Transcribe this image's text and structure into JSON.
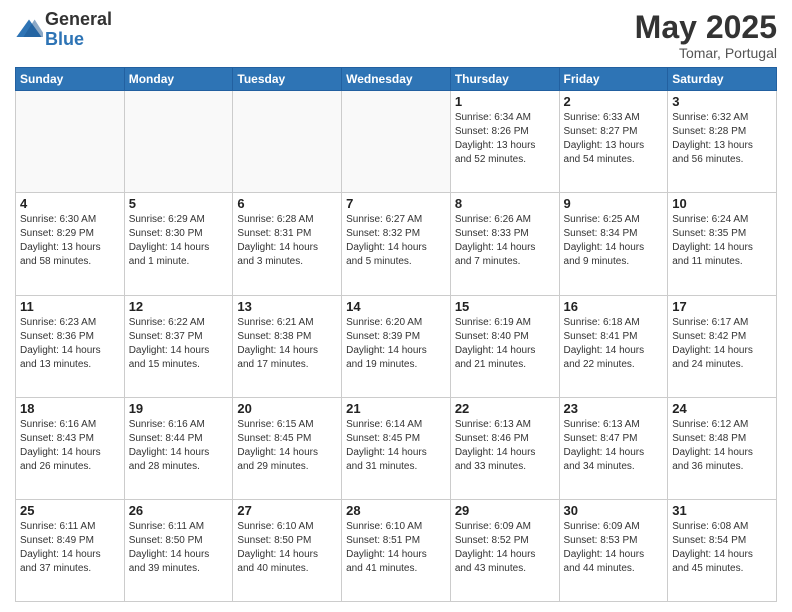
{
  "header": {
    "logo_general": "General",
    "logo_blue": "Blue",
    "title": "May 2025",
    "location": "Tomar, Portugal"
  },
  "days_of_week": [
    "Sunday",
    "Monday",
    "Tuesday",
    "Wednesday",
    "Thursday",
    "Friday",
    "Saturday"
  ],
  "weeks": [
    [
      {
        "day": "",
        "info": ""
      },
      {
        "day": "",
        "info": ""
      },
      {
        "day": "",
        "info": ""
      },
      {
        "day": "",
        "info": ""
      },
      {
        "day": "1",
        "info": "Sunrise: 6:34 AM\nSunset: 8:26 PM\nDaylight: 13 hours\nand 52 minutes."
      },
      {
        "day": "2",
        "info": "Sunrise: 6:33 AM\nSunset: 8:27 PM\nDaylight: 13 hours\nand 54 minutes."
      },
      {
        "day": "3",
        "info": "Sunrise: 6:32 AM\nSunset: 8:28 PM\nDaylight: 13 hours\nand 56 minutes."
      }
    ],
    [
      {
        "day": "4",
        "info": "Sunrise: 6:30 AM\nSunset: 8:29 PM\nDaylight: 13 hours\nand 58 minutes."
      },
      {
        "day": "5",
        "info": "Sunrise: 6:29 AM\nSunset: 8:30 PM\nDaylight: 14 hours\nand 1 minute."
      },
      {
        "day": "6",
        "info": "Sunrise: 6:28 AM\nSunset: 8:31 PM\nDaylight: 14 hours\nand 3 minutes."
      },
      {
        "day": "7",
        "info": "Sunrise: 6:27 AM\nSunset: 8:32 PM\nDaylight: 14 hours\nand 5 minutes."
      },
      {
        "day": "8",
        "info": "Sunrise: 6:26 AM\nSunset: 8:33 PM\nDaylight: 14 hours\nand 7 minutes."
      },
      {
        "day": "9",
        "info": "Sunrise: 6:25 AM\nSunset: 8:34 PM\nDaylight: 14 hours\nand 9 minutes."
      },
      {
        "day": "10",
        "info": "Sunrise: 6:24 AM\nSunset: 8:35 PM\nDaylight: 14 hours\nand 11 minutes."
      }
    ],
    [
      {
        "day": "11",
        "info": "Sunrise: 6:23 AM\nSunset: 8:36 PM\nDaylight: 14 hours\nand 13 minutes."
      },
      {
        "day": "12",
        "info": "Sunrise: 6:22 AM\nSunset: 8:37 PM\nDaylight: 14 hours\nand 15 minutes."
      },
      {
        "day": "13",
        "info": "Sunrise: 6:21 AM\nSunset: 8:38 PM\nDaylight: 14 hours\nand 17 minutes."
      },
      {
        "day": "14",
        "info": "Sunrise: 6:20 AM\nSunset: 8:39 PM\nDaylight: 14 hours\nand 19 minutes."
      },
      {
        "day": "15",
        "info": "Sunrise: 6:19 AM\nSunset: 8:40 PM\nDaylight: 14 hours\nand 21 minutes."
      },
      {
        "day": "16",
        "info": "Sunrise: 6:18 AM\nSunset: 8:41 PM\nDaylight: 14 hours\nand 22 minutes."
      },
      {
        "day": "17",
        "info": "Sunrise: 6:17 AM\nSunset: 8:42 PM\nDaylight: 14 hours\nand 24 minutes."
      }
    ],
    [
      {
        "day": "18",
        "info": "Sunrise: 6:16 AM\nSunset: 8:43 PM\nDaylight: 14 hours\nand 26 minutes."
      },
      {
        "day": "19",
        "info": "Sunrise: 6:16 AM\nSunset: 8:44 PM\nDaylight: 14 hours\nand 28 minutes."
      },
      {
        "day": "20",
        "info": "Sunrise: 6:15 AM\nSunset: 8:45 PM\nDaylight: 14 hours\nand 29 minutes."
      },
      {
        "day": "21",
        "info": "Sunrise: 6:14 AM\nSunset: 8:45 PM\nDaylight: 14 hours\nand 31 minutes."
      },
      {
        "day": "22",
        "info": "Sunrise: 6:13 AM\nSunset: 8:46 PM\nDaylight: 14 hours\nand 33 minutes."
      },
      {
        "day": "23",
        "info": "Sunrise: 6:13 AM\nSunset: 8:47 PM\nDaylight: 14 hours\nand 34 minutes."
      },
      {
        "day": "24",
        "info": "Sunrise: 6:12 AM\nSunset: 8:48 PM\nDaylight: 14 hours\nand 36 minutes."
      }
    ],
    [
      {
        "day": "25",
        "info": "Sunrise: 6:11 AM\nSunset: 8:49 PM\nDaylight: 14 hours\nand 37 minutes."
      },
      {
        "day": "26",
        "info": "Sunrise: 6:11 AM\nSunset: 8:50 PM\nDaylight: 14 hours\nand 39 minutes."
      },
      {
        "day": "27",
        "info": "Sunrise: 6:10 AM\nSunset: 8:50 PM\nDaylight: 14 hours\nand 40 minutes."
      },
      {
        "day": "28",
        "info": "Sunrise: 6:10 AM\nSunset: 8:51 PM\nDaylight: 14 hours\nand 41 minutes."
      },
      {
        "day": "29",
        "info": "Sunrise: 6:09 AM\nSunset: 8:52 PM\nDaylight: 14 hours\nand 43 minutes."
      },
      {
        "day": "30",
        "info": "Sunrise: 6:09 AM\nSunset: 8:53 PM\nDaylight: 14 hours\nand 44 minutes."
      },
      {
        "day": "31",
        "info": "Sunrise: 6:08 AM\nSunset: 8:54 PM\nDaylight: 14 hours\nand 45 minutes."
      }
    ]
  ]
}
